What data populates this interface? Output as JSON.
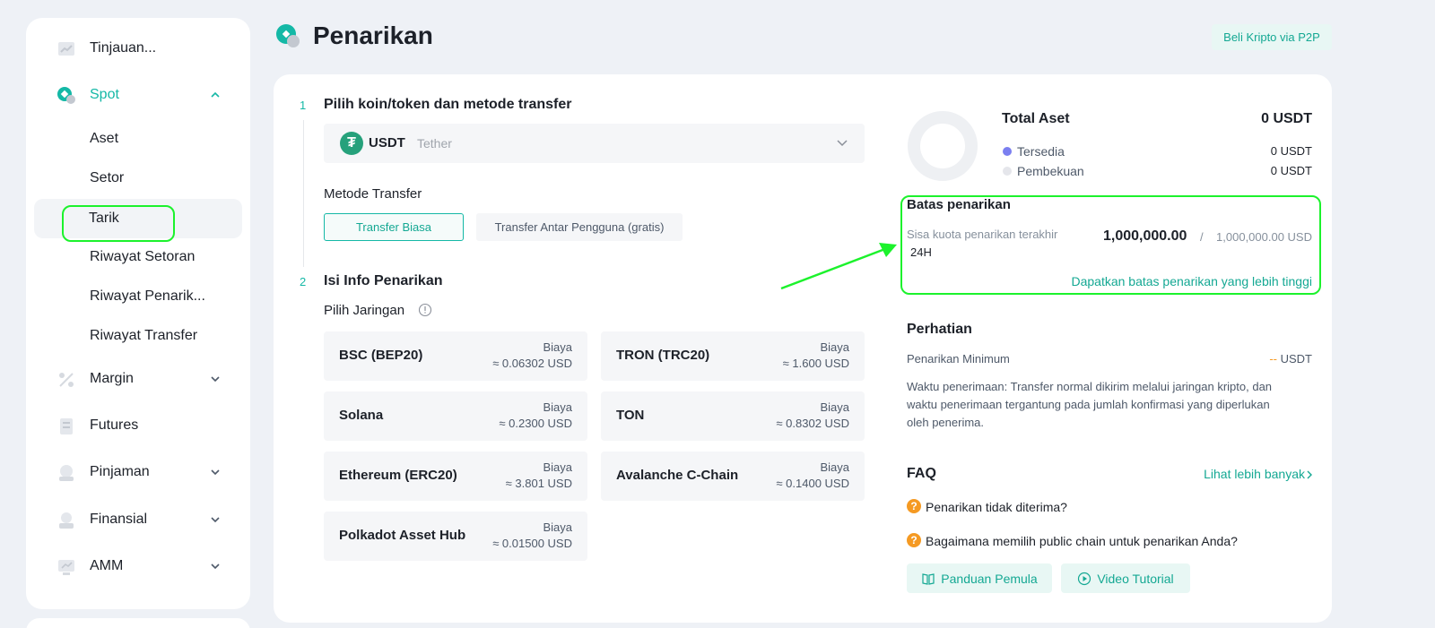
{
  "sidebar": {
    "items": [
      {
        "label": "Tinjauan...",
        "icon": "overview-icon"
      },
      {
        "label": "Spot",
        "icon": "spot-icon",
        "expanded": true
      },
      {
        "label": "Margin",
        "icon": "margin-icon"
      },
      {
        "label": "Futures",
        "icon": "futures-icon"
      },
      {
        "label": "Pinjaman",
        "icon": "loan-icon"
      },
      {
        "label": "Finansial",
        "icon": "finance-icon"
      },
      {
        "label": "AMM",
        "icon": "amm-icon"
      }
    ],
    "spot_sub": [
      {
        "label": "Aset"
      },
      {
        "label": "Setor"
      },
      {
        "label": "Tarik",
        "selected": true
      },
      {
        "label": "Riwayat Setoran"
      },
      {
        "label": "Riwayat Penarik..."
      },
      {
        "label": "Riwayat Transfer"
      }
    ]
  },
  "header": {
    "title": "Penarikan",
    "p2p_button": "Beli Kripto via P2P"
  },
  "step1": {
    "number": "1",
    "title": "Pilih koin/token dan metode transfer",
    "coin_symbol": "USDT",
    "coin_name": "Tether",
    "method_label": "Metode Transfer",
    "method_active": "Transfer Biasa",
    "method_other": "Transfer Antar Pengguna (gratis)"
  },
  "step2": {
    "number": "2",
    "title": "Isi Info Penarikan",
    "network_label": "Pilih Jaringan",
    "networks": [
      {
        "name": "BSC (BEP20)",
        "fee_label": "Biaya",
        "fee": "≈ 0.06302 USD"
      },
      {
        "name": "TRON (TRC20)",
        "fee_label": "Biaya",
        "fee": "≈ 1.600 USD"
      },
      {
        "name": "Solana",
        "fee_label": "Biaya",
        "fee": "≈ 0.2300 USD"
      },
      {
        "name": "TON",
        "fee_label": "Biaya",
        "fee": "≈ 0.8302 USD"
      },
      {
        "name": "Ethereum (ERC20)",
        "fee_label": "Biaya",
        "fee": "≈ 3.801 USD"
      },
      {
        "name": "Avalanche C-Chain",
        "fee_label": "Biaya",
        "fee": "≈ 0.1400 USD"
      },
      {
        "name": "Polkadot Asset Hub",
        "fee_label": "Biaya",
        "fee": "≈ 0.01500 USD"
      }
    ]
  },
  "assets": {
    "title": "Total Aset",
    "total": "0 USDT",
    "available_label": "Tersedia",
    "available": "0 USDT",
    "frozen_label": "Pembekuan",
    "frozen": "0 USDT",
    "available_color": "#7b7ff0",
    "frozen_color": "#e5e6eb"
  },
  "limit": {
    "title": "Batas penarikan",
    "desc_line1": "Sisa kuota penarikan terakhir",
    "desc_line2": "24H",
    "remaining": "1,000,000.00",
    "separator": "/",
    "total": "1,000,000.00 USD",
    "link": "Dapatkan batas penarikan yang lebih tinggi"
  },
  "notice": {
    "title": "Perhatian",
    "min_label": "Penarikan Minimum",
    "min_value": "--",
    "min_unit": "USDT",
    "line1": "Waktu penerimaan: Transfer normal dikirim melalui jaringan kripto, dan",
    "line2": "waktu penerimaan tergantung pada jumlah konfirmasi yang diperlukan",
    "line3": "oleh penerima."
  },
  "faq": {
    "title": "FAQ",
    "more": "Lihat lebih banyak",
    "q1": "Penarikan tidak diterima?",
    "q2": "Bagaimana memilih public chain untuk penarikan Anda?",
    "guide": "Panduan Pemula",
    "video": "Video Tutorial"
  },
  "colors": {
    "accent": "#14b8a6",
    "highlight": "#1cf22c",
    "faq_icon": "#f59a23"
  }
}
